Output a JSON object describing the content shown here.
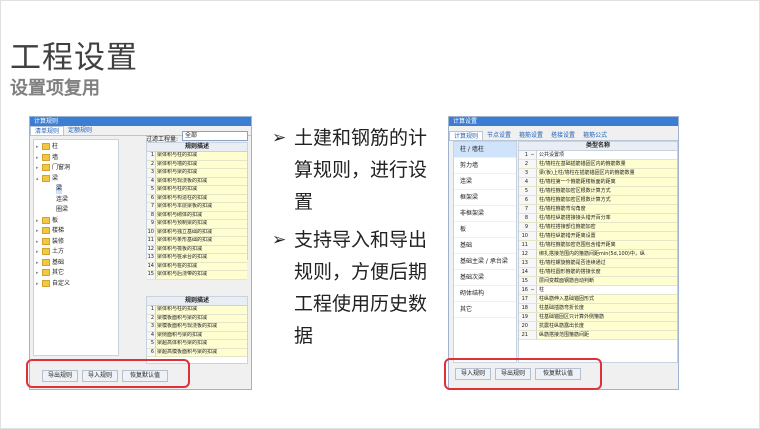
{
  "title": "工程设置",
  "subtitle": "设置项复用",
  "left_window": {
    "title": "计算规则",
    "tabs": [
      "清单规则",
      "定额规则"
    ],
    "filter_label": "过滤工程量:",
    "filter_value": "全部",
    "tree": [
      {
        "label": "柱",
        "level": 0,
        "expanded": false
      },
      {
        "label": "墙",
        "level": 0,
        "expanded": false
      },
      {
        "label": "门窗洞",
        "level": 0,
        "expanded": false
      },
      {
        "label": "梁",
        "level": 0,
        "expanded": true
      },
      {
        "label": "梁",
        "level": 1,
        "selected": true
      },
      {
        "label": "连梁",
        "level": 1
      },
      {
        "label": "圈梁",
        "level": 1
      },
      {
        "label": "板",
        "level": 0,
        "expanded": false
      },
      {
        "label": "楼梯",
        "level": 0,
        "expanded": false
      },
      {
        "label": "装修",
        "level": 0,
        "expanded": false
      },
      {
        "label": "土方",
        "level": 0,
        "expanded": false
      },
      {
        "label": "基础",
        "level": 0,
        "expanded": false
      },
      {
        "label": "其它",
        "level": 0,
        "expanded": false
      },
      {
        "label": "自定义",
        "level": 0,
        "expanded": false
      }
    ],
    "rules_header": "规则描述",
    "rules": [
      "梁体积与柱的扣减",
      "梁体积与墙的扣减",
      "梁体积与梁的扣减",
      "梁体积与现浇板的扣减",
      "梁体积与柱的扣减",
      "梁体积与构造柱的扣减",
      "梁体积与本层梁板的扣减",
      "梁体积与砌体的扣减",
      "梁体积与预制梁的扣减",
      "梁体积与独立基础的扣减",
      "梁体积与条形基础的扣减",
      "梁体积与筏板的扣减",
      "梁体积与桩承台的扣减",
      "梁体积与桩的扣减",
      "梁体积与后浇带的扣减"
    ],
    "rules2_header": "规则描述",
    "rules2": [
      "梁体积与柱的扣减",
      "梁模板面积与梁的扣减",
      "梁模板面积与现浇板的扣减",
      "梁侧面积与梁的扣减",
      "梁超高体积与梁的扣减",
      "梁超高模板面积与梁的扣减"
    ],
    "buttons": [
      "导出规则",
      "导入规则",
      "恢复默认值"
    ]
  },
  "bullets": [
    "土建和钢筋的计算规则，进行设置",
    "支持导入和导出规则，方便后期工程使用历史数据"
  ],
  "right_window": {
    "title": "计算设置",
    "tabs": [
      "计算规则",
      "节点设置",
      "箍筋设置",
      "搭接设置",
      "箍筋公式"
    ],
    "side_items": [
      "柱 / 墙柱",
      "剪力墙",
      "连梁",
      "框架梁",
      "非框架梁",
      "板",
      "基础",
      "基础主梁 / 承台梁",
      "基础次梁",
      "砌体结构",
      "其它"
    ],
    "rules_header": "类型名称",
    "rules": [
      {
        "n": "1",
        "e": "−",
        "t": "公共设置项",
        "group": true
      },
      {
        "n": "2",
        "t": "柱/墙柱在基础插筋锚固区内的箍筋数量"
      },
      {
        "n": "3",
        "t": "梁(板)上柱/墙柱在插筋锚固区内的箍筋数量"
      },
      {
        "n": "4",
        "t": "柱/墙柱第一个箍筋距楼板面的距离"
      },
      {
        "n": "5",
        "t": "柱/墙柱箍筋加密区根数计算方式"
      },
      {
        "n": "6",
        "t": "柱/墙柱箍筋加密区根数计算方式"
      },
      {
        "n": "7",
        "t": "柱/墙柱箍筋弯勾角度"
      },
      {
        "n": "8",
        "t": "柱/墙柱纵筋搭接接头错开百分率"
      },
      {
        "n": "9",
        "t": "柱/墙柱搭接部位箍筋加密"
      },
      {
        "n": "10",
        "t": "柱/墙柱纵筋错开距离设置"
      },
      {
        "n": "11",
        "t": "柱/墙柱箍筋加密范围包含错开距离"
      },
      {
        "n": "12",
        "t": "绑扎搭接范围内的箍筋间距min(5d,100)中，纵"
      },
      {
        "n": "13",
        "t": "柱/墙柱螺旋箍筋是否连续通过"
      },
      {
        "n": "14",
        "t": "柱/墙柱圆形箍筋的搭接长度"
      },
      {
        "n": "15",
        "t": "层间变截面钢筋自动判断"
      },
      {
        "n": "16",
        "e": "−",
        "t": "柱",
        "group": true
      },
      {
        "n": "17",
        "t": "柱纵筋伸入基础锚固形式"
      },
      {
        "n": "18",
        "t": "柱基础插筋弯折长度"
      },
      {
        "n": "19",
        "t": "柱基础锚固区只计算外侧箍筋"
      },
      {
        "n": "20",
        "t": "抗震柱纵筋露出长度"
      },
      {
        "n": "21",
        "t": "纵筋搭接范围箍筋间距"
      }
    ],
    "buttons": [
      "导入规则",
      "导出规则",
      "恢复默认值"
    ]
  }
}
